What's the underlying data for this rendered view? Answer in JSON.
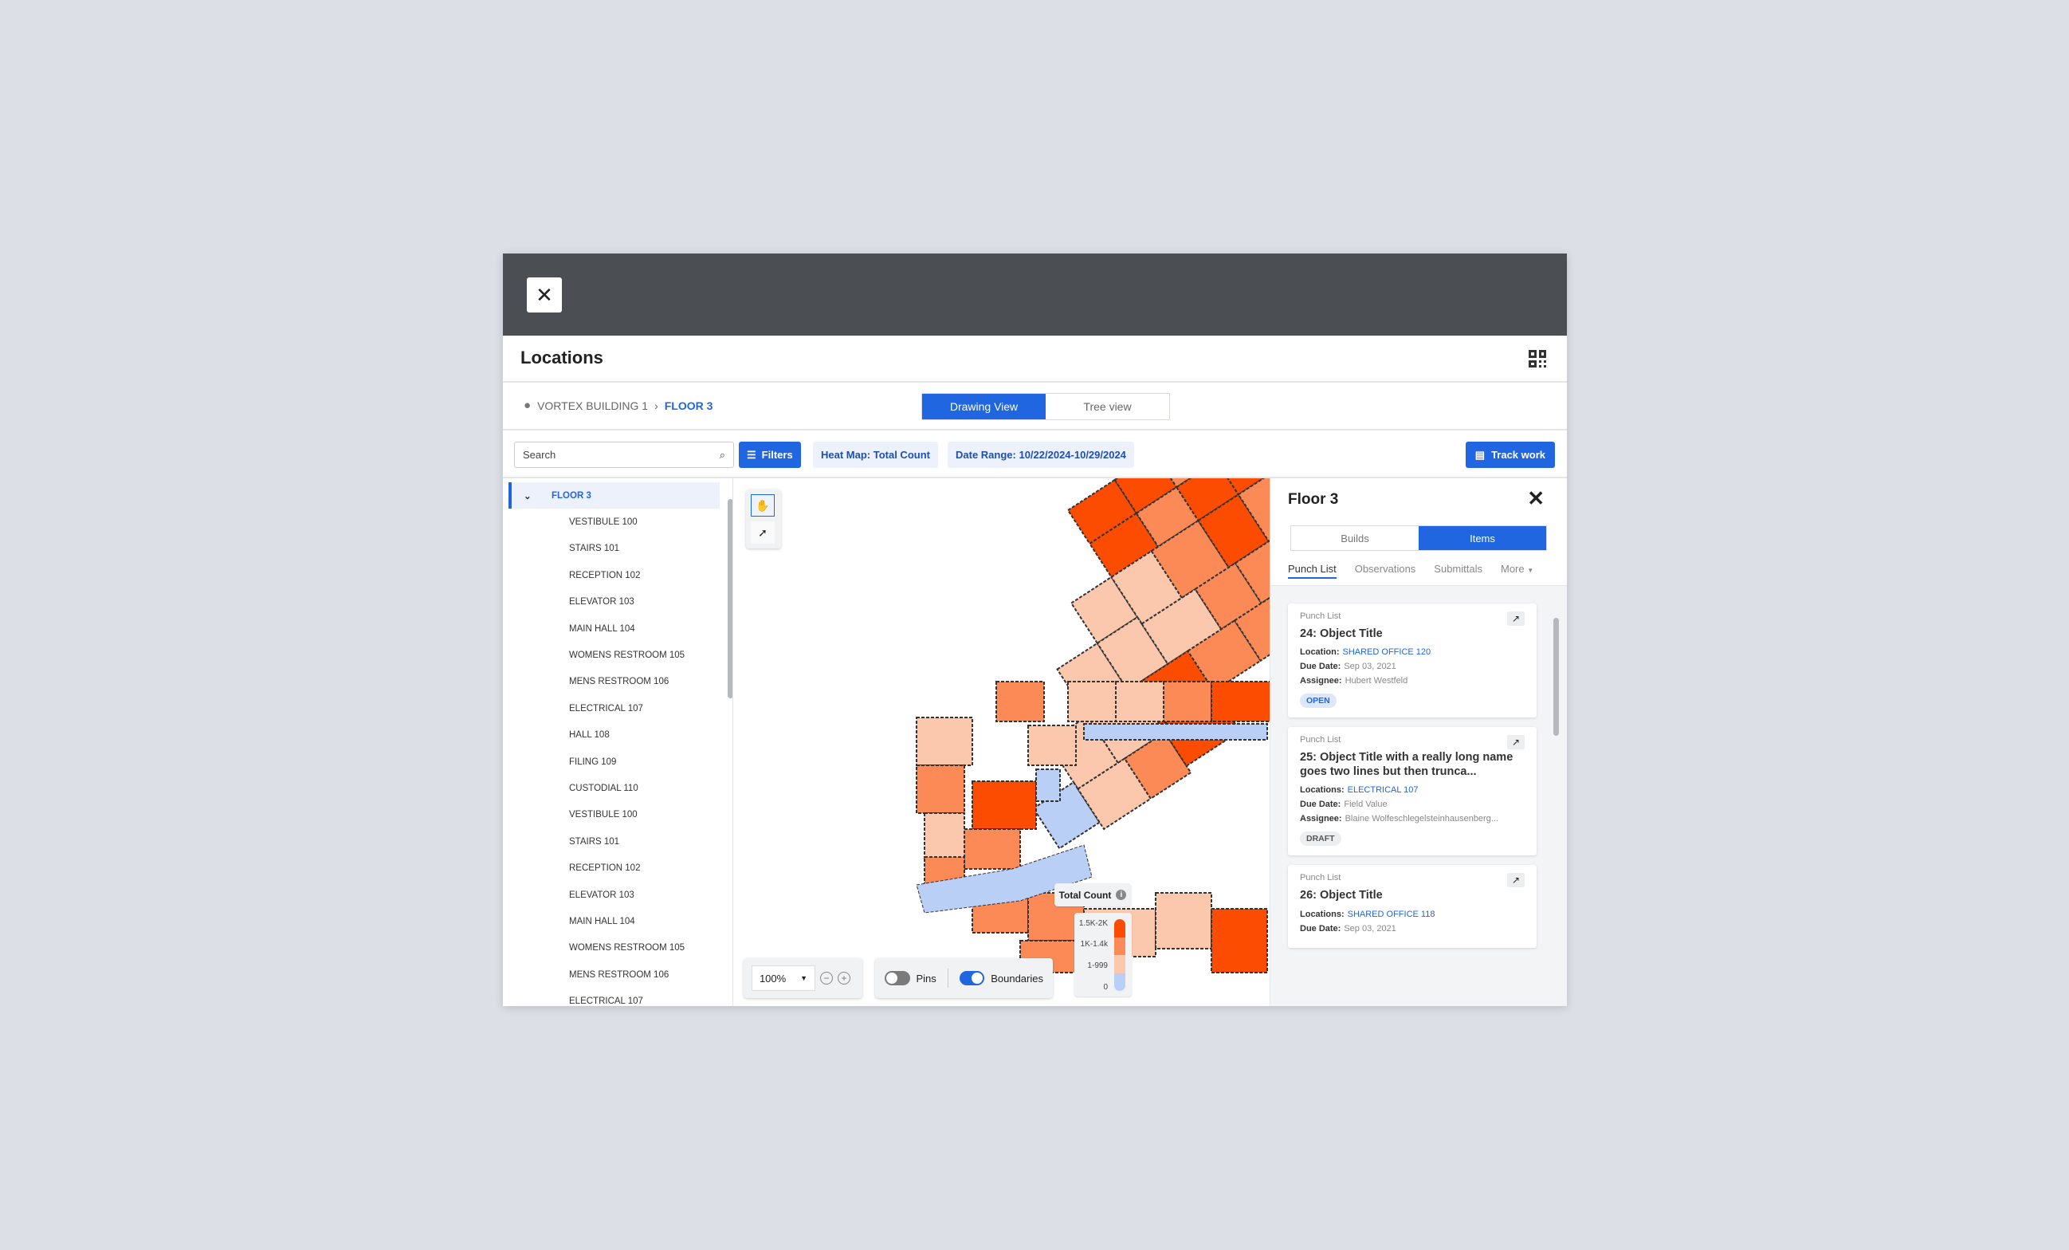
{
  "header": {
    "close_icon": "close-icon",
    "title": "Locations",
    "qr_icon": "qr-code-icon"
  },
  "breadcrumb": {
    "items": [
      "VORTEX BUILDING 1",
      "FLOOR 3"
    ]
  },
  "view_toggle": {
    "options": [
      "Drawing View",
      "Tree view"
    ],
    "selected": "Drawing View"
  },
  "toolbar": {
    "search_placeholder": "Search",
    "filters": "Filters",
    "heat_map": "Heat Map: Total Count",
    "date_range": "Date Range: 10/22/2024-10/29/2024",
    "track_work": "Track work"
  },
  "tree": {
    "root": "FLOOR 3",
    "items": [
      "VESTIBULE 100",
      "STAIRS 101",
      "RECEPTION 102",
      "ELEVATOR 103",
      "MAIN HALL 104",
      "WOMENS RESTROOM 105",
      "MENS RESTROOM 106",
      "ELECTRICAL 107",
      "HALL 108",
      "FILING 109",
      "CUSTODIAL 110",
      "VESTIBULE 100",
      "STAIRS 101",
      "RECEPTION 102",
      "ELEVATOR 103",
      "MAIN HALL 104",
      "WOMENS RESTROOM 105",
      "MENS RESTROOM 106",
      "ELECTRICAL 107"
    ]
  },
  "map": {
    "zoom": "100%",
    "pins_label": "Pins",
    "pins_on": false,
    "boundaries_label": "Boundaries",
    "boundaries_on": true,
    "legend": {
      "title": "Total Count",
      "ranges": [
        "1.5K-2K",
        "1K-1.4k",
        "1-999",
        "0"
      ],
      "colors": [
        "#fc4c02",
        "#fb8a56",
        "#fbc7ad",
        "#b9cff5"
      ]
    }
  },
  "panel": {
    "title": "Floor 3",
    "segments": [
      "Builds",
      "Items"
    ],
    "selected_segment": "Items",
    "tabs": [
      "Punch List",
      "Observations",
      "Submittals",
      "More"
    ],
    "active_tab": "Punch List",
    "cards": [
      {
        "kind": "Punch List",
        "title": "24: Object Title",
        "loc_label": "Location:",
        "loc": "SHARED OFFICE 120",
        "due_label": "Due Date:",
        "due": "Sep 03, 2021",
        "assignee_label": "Assignee:",
        "assignee": "Hubert Westfeld",
        "status": "OPEN"
      },
      {
        "kind": "Punch List",
        "title": "25: Object Title with a really long name goes two lines but then trunca...",
        "loc_label": "Locations:",
        "loc": "ELECTRICAL 107",
        "due_label": "Due Date:",
        "due": "Field Value",
        "assignee_label": "Assignee:",
        "assignee": "Blaine Wolfeschlegelsteinhausenberg...",
        "status": "DRAFT"
      },
      {
        "kind": "Punch List",
        "title": "26: Object Title",
        "loc_label": "Locations:",
        "loc": "SHARED OFFICE 118",
        "due_label": "Due Date:",
        "due": "Sep 03, 2021"
      }
    ]
  }
}
